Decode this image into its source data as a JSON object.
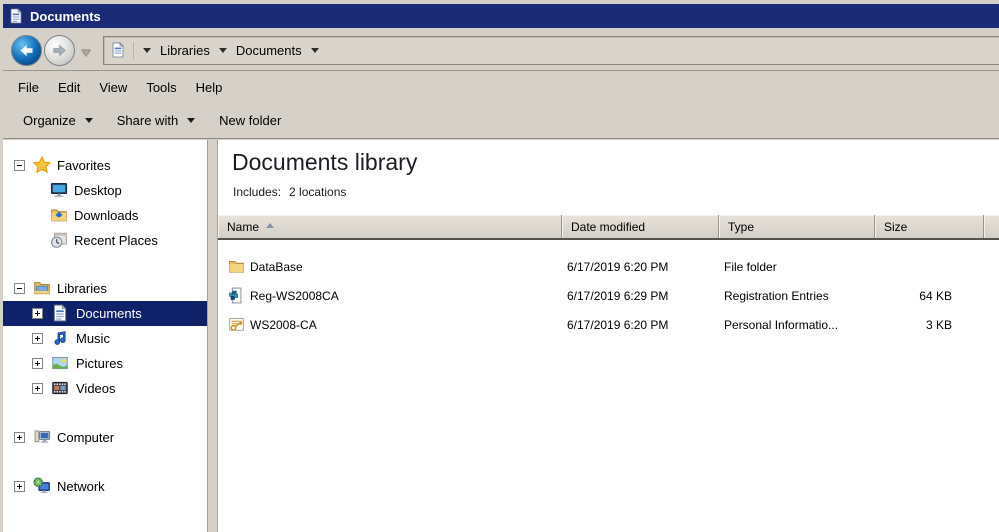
{
  "window": {
    "title": "Documents"
  },
  "nav": {
    "breadcrumb": [
      {
        "label": "Libraries"
      },
      {
        "label": "Documents"
      }
    ]
  },
  "menu": {
    "items": [
      {
        "label": "File"
      },
      {
        "label": "Edit"
      },
      {
        "label": "View"
      },
      {
        "label": "Tools"
      },
      {
        "label": "Help"
      }
    ]
  },
  "toolbar": {
    "organize_label": "Organize",
    "share_label": "Share with",
    "new_folder_label": "New folder"
  },
  "sidebar": {
    "items": [
      {
        "label": "Favorites",
        "icon": "favorites-star-icon",
        "expander": "minus"
      },
      {
        "label": "Desktop",
        "icon": "desktop-icon",
        "expander": "none"
      },
      {
        "label": "Downloads",
        "icon": "downloads-icon",
        "expander": "none"
      },
      {
        "label": "Recent Places",
        "icon": "recent-places-icon",
        "expander": "none"
      },
      {
        "label": "Libraries",
        "icon": "libraries-icon",
        "expander": "minus"
      },
      {
        "label": "Documents",
        "icon": "documents-icon",
        "expander": "plus",
        "selected": true
      },
      {
        "label": "Music",
        "icon": "music-icon",
        "expander": "plus"
      },
      {
        "label": "Pictures",
        "icon": "pictures-icon",
        "expander": "plus"
      },
      {
        "label": "Videos",
        "icon": "videos-icon",
        "expander": "plus"
      },
      {
        "label": "Computer",
        "icon": "computer-icon",
        "expander": "plus"
      },
      {
        "label": "Network",
        "icon": "network-icon",
        "expander": "plus"
      }
    ]
  },
  "library": {
    "title": "Documents library",
    "includes_label": "Includes:",
    "includes_value": "2 locations"
  },
  "columns": [
    {
      "label": "Name",
      "sorted": "asc"
    },
    {
      "label": "Date modified"
    },
    {
      "label": "Type"
    },
    {
      "label": "Size"
    }
  ],
  "files": [
    {
      "name": "DataBase",
      "date": "6/17/2019 6:20 PM",
      "type": "File folder",
      "size": "",
      "icon": "folder-icon"
    },
    {
      "name": "Reg-WS2008CA",
      "date": "6/17/2019 6:29 PM",
      "type": "Registration Entries",
      "size": "64 KB",
      "icon": "registry-file-icon"
    },
    {
      "name": "WS2008-CA",
      "date": "6/17/2019 6:20 PM",
      "type": "Personal Informatio...",
      "size": "3 KB",
      "icon": "certificate-file-icon"
    }
  ],
  "colors": {
    "titlebar_blue": "#1b2a74",
    "selection_blue": "#0f2168",
    "window_face": "#d5d1c9",
    "folder_yellow": "#eecb6b"
  }
}
